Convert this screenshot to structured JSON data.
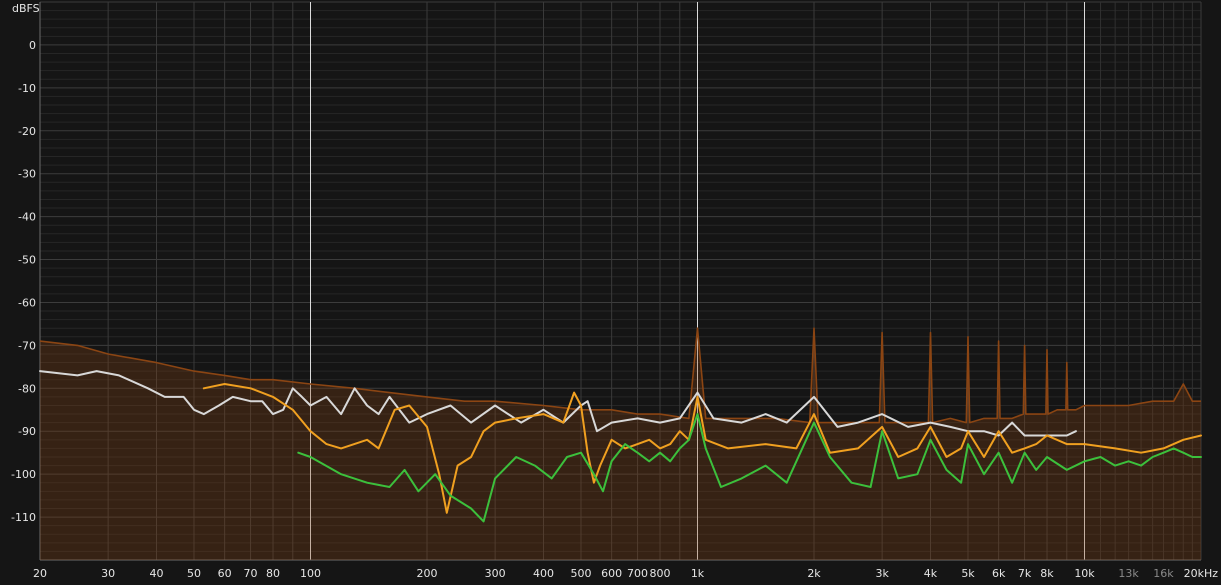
{
  "chart_data": {
    "type": "line",
    "ylabel": "dBFS",
    "x_scale": "log",
    "xlim": [
      20,
      20000
    ],
    "ylim": [
      -120,
      10
    ],
    "grid": true,
    "x_ticks": [
      {
        "value": 20,
        "label": "20"
      },
      {
        "value": 30,
        "label": "30"
      },
      {
        "value": 40,
        "label": "40"
      },
      {
        "value": 50,
        "label": "50"
      },
      {
        "value": 60,
        "label": "60"
      },
      {
        "value": 70,
        "label": "70"
      },
      {
        "value": 80,
        "label": "80"
      },
      {
        "value": 100,
        "label": "100"
      },
      {
        "value": 200,
        "label": "200"
      },
      {
        "value": 300,
        "label": "300"
      },
      {
        "value": 400,
        "label": "400"
      },
      {
        "value": 500,
        "label": "500"
      },
      {
        "value": 600,
        "label": "600"
      },
      {
        "value": 700,
        "label": "700"
      },
      {
        "value": 800,
        "label": "800"
      },
      {
        "value": 1000,
        "label": "1k"
      },
      {
        "value": 2000,
        "label": "2k"
      },
      {
        "value": 3000,
        "label": "3k"
      },
      {
        "value": 4000,
        "label": "4k"
      },
      {
        "value": 5000,
        "label": "5k"
      },
      {
        "value": 6000,
        "label": "6k"
      },
      {
        "value": 7000,
        "label": "7k"
      },
      {
        "value": 8000,
        "label": "8k"
      },
      {
        "value": 10000,
        "label": "10k"
      },
      {
        "value": 13000,
        "label": "13k"
      },
      {
        "value": 16000,
        "label": "16k"
      },
      {
        "value": 20000,
        "label": "20kHz"
      }
    ],
    "y_ticks": [
      0,
      -10,
      -20,
      -30,
      -40,
      -50,
      -60,
      -70,
      -80,
      -90,
      -100,
      -110
    ],
    "series": [
      {
        "color": "#8b4513",
        "style": "filled",
        "points": [
          [
            20,
            -69
          ],
          [
            25,
            -70
          ],
          [
            30,
            -72
          ],
          [
            40,
            -74
          ],
          [
            50,
            -76
          ],
          [
            60,
            -77
          ],
          [
            70,
            -78
          ],
          [
            80,
            -78
          ],
          [
            100,
            -79
          ],
          [
            130,
            -80
          ],
          [
            160,
            -81
          ],
          [
            200,
            -82
          ],
          [
            250,
            -83
          ],
          [
            300,
            -83
          ],
          [
            400,
            -84
          ],
          [
            500,
            -85
          ],
          [
            600,
            -85
          ],
          [
            700,
            -86
          ],
          [
            800,
            -86
          ],
          [
            950,
            -87
          ],
          [
            1000,
            -66
          ],
          [
            1050,
            -87
          ],
          [
            1300,
            -87
          ],
          [
            1600,
            -87
          ],
          [
            1950,
            -88
          ],
          [
            2000,
            -66
          ],
          [
            2050,
            -88
          ],
          [
            2500,
            -88
          ],
          [
            2950,
            -88
          ],
          [
            3000,
            -67
          ],
          [
            3050,
            -88
          ],
          [
            3500,
            -88
          ],
          [
            3950,
            -88
          ],
          [
            4000,
            -67
          ],
          [
            4050,
            -88
          ],
          [
            4500,
            -87
          ],
          [
            4950,
            -88
          ],
          [
            5000,
            -68
          ],
          [
            5050,
            -88
          ],
          [
            5500,
            -87
          ],
          [
            5950,
            -87
          ],
          [
            6000,
            -69
          ],
          [
            6050,
            -87
          ],
          [
            6500,
            -87
          ],
          [
            6950,
            -86
          ],
          [
            7000,
            -70
          ],
          [
            7050,
            -86
          ],
          [
            7500,
            -86
          ],
          [
            7950,
            -86
          ],
          [
            8000,
            -71
          ],
          [
            8050,
            -86
          ],
          [
            8500,
            -85
          ],
          [
            8950,
            -85
          ],
          [
            9000,
            -74
          ],
          [
            9050,
            -85
          ],
          [
            9500,
            -85
          ],
          [
            10000,
            -84
          ],
          [
            11000,
            -84
          ],
          [
            12000,
            -84
          ],
          [
            13000,
            -84
          ],
          [
            15000,
            -83
          ],
          [
            17000,
            -83
          ],
          [
            18000,
            -79
          ],
          [
            19000,
            -83
          ],
          [
            20000,
            -83
          ]
        ]
      },
      {
        "color": "#d8d8d8",
        "style": "line",
        "points": [
          [
            20,
            -76
          ],
          [
            25,
            -77
          ],
          [
            28,
            -76
          ],
          [
            32,
            -77
          ],
          [
            38,
            -80
          ],
          [
            42,
            -82
          ],
          [
            47,
            -82
          ],
          [
            50,
            -85
          ],
          [
            53,
            -86
          ],
          [
            58,
            -84
          ],
          [
            63,
            -82
          ],
          [
            70,
            -83
          ],
          [
            75,
            -83
          ],
          [
            80,
            -86
          ],
          [
            85,
            -85
          ],
          [
            90,
            -80
          ],
          [
            95,
            -82
          ],
          [
            100,
            -84
          ],
          [
            110,
            -82
          ],
          [
            120,
            -86
          ],
          [
            130,
            -80
          ],
          [
            140,
            -84
          ],
          [
            150,
            -86
          ],
          [
            160,
            -82
          ],
          [
            180,
            -88
          ],
          [
            200,
            -86
          ],
          [
            230,
            -84
          ],
          [
            260,
            -88
          ],
          [
            300,
            -84
          ],
          [
            350,
            -88
          ],
          [
            400,
            -85
          ],
          [
            450,
            -88
          ],
          [
            500,
            -84
          ],
          [
            520,
            -83
          ],
          [
            550,
            -90
          ],
          [
            600,
            -88
          ],
          [
            700,
            -87
          ],
          [
            800,
            -88
          ],
          [
            900,
            -87
          ],
          [
            1000,
            -81
          ],
          [
            1100,
            -87
          ],
          [
            1300,
            -88
          ],
          [
            1500,
            -86
          ],
          [
            1700,
            -88
          ],
          [
            2000,
            -82
          ],
          [
            2300,
            -89
          ],
          [
            2600,
            -88
          ],
          [
            3000,
            -86
          ],
          [
            3500,
            -89
          ],
          [
            4000,
            -88
          ],
          [
            4500,
            -89
          ],
          [
            5000,
            -90
          ],
          [
            5500,
            -90
          ],
          [
            6000,
            -91
          ],
          [
            6500,
            -88
          ],
          [
            7000,
            -91
          ],
          [
            7500,
            -91
          ],
          [
            8000,
            -91
          ],
          [
            8500,
            -91
          ],
          [
            9000,
            -91
          ],
          [
            9500,
            -90
          ]
        ]
      },
      {
        "color": "#f0a020",
        "style": "line",
        "points": [
          [
            53,
            -80
          ],
          [
            60,
            -79
          ],
          [
            70,
            -80
          ],
          [
            80,
            -82
          ],
          [
            90,
            -85
          ],
          [
            100,
            -90
          ],
          [
            110,
            -93
          ],
          [
            120,
            -94
          ],
          [
            140,
            -92
          ],
          [
            150,
            -94
          ],
          [
            165,
            -85
          ],
          [
            180,
            -84
          ],
          [
            200,
            -89
          ],
          [
            215,
            -100
          ],
          [
            225,
            -109
          ],
          [
            240,
            -98
          ],
          [
            260,
            -96
          ],
          [
            280,
            -90
          ],
          [
            300,
            -88
          ],
          [
            340,
            -87
          ],
          [
            400,
            -86
          ],
          [
            450,
            -88
          ],
          [
            480,
            -81
          ],
          [
            500,
            -84
          ],
          [
            520,
            -95
          ],
          [
            540,
            -102
          ],
          [
            560,
            -98
          ],
          [
            600,
            -92
          ],
          [
            650,
            -94
          ],
          [
            700,
            -93
          ],
          [
            750,
            -92
          ],
          [
            800,
            -94
          ],
          [
            850,
            -93
          ],
          [
            900,
            -90
          ],
          [
            950,
            -92
          ],
          [
            1000,
            -82
          ],
          [
            1050,
            -92
          ],
          [
            1200,
            -94
          ],
          [
            1500,
            -93
          ],
          [
            1800,
            -94
          ],
          [
            2000,
            -86
          ],
          [
            2200,
            -95
          ],
          [
            2600,
            -94
          ],
          [
            3000,
            -89
          ],
          [
            3300,
            -96
          ],
          [
            3700,
            -94
          ],
          [
            4000,
            -89
          ],
          [
            4400,
            -96
          ],
          [
            4800,
            -94
          ],
          [
            5000,
            -90
          ],
          [
            5500,
            -96
          ],
          [
            6000,
            -90
          ],
          [
            6500,
            -95
          ],
          [
            7000,
            -94
          ],
          [
            7500,
            -93
          ],
          [
            8000,
            -91
          ],
          [
            9000,
            -93
          ],
          [
            10000,
            -93
          ],
          [
            12000,
            -94
          ],
          [
            14000,
            -95
          ],
          [
            16000,
            -94
          ],
          [
            18000,
            -92
          ],
          [
            20000,
            -91
          ]
        ]
      },
      {
        "color": "#3cc03c",
        "style": "line",
        "points": [
          [
            93,
            -95
          ],
          [
            100,
            -96
          ],
          [
            120,
            -100
          ],
          [
            140,
            -102
          ],
          [
            160,
            -103
          ],
          [
            175,
            -99
          ],
          [
            190,
            -104
          ],
          [
            210,
            -100
          ],
          [
            230,
            -105
          ],
          [
            260,
            -108
          ],
          [
            280,
            -111
          ],
          [
            300,
            -101
          ],
          [
            340,
            -96
          ],
          [
            380,
            -98
          ],
          [
            420,
            -101
          ],
          [
            460,
            -96
          ],
          [
            500,
            -95
          ],
          [
            540,
            -100
          ],
          [
            570,
            -104
          ],
          [
            600,
            -97
          ],
          [
            650,
            -93
          ],
          [
            700,
            -95
          ],
          [
            750,
            -97
          ],
          [
            800,
            -95
          ],
          [
            850,
            -97
          ],
          [
            900,
            -94
          ],
          [
            950,
            -92
          ],
          [
            1000,
            -86
          ],
          [
            1050,
            -94
          ],
          [
            1150,
            -103
          ],
          [
            1300,
            -101
          ],
          [
            1500,
            -98
          ],
          [
            1700,
            -102
          ],
          [
            2000,
            -88
          ],
          [
            2200,
            -96
          ],
          [
            2500,
            -102
          ],
          [
            2800,
            -103
          ],
          [
            3000,
            -90
          ],
          [
            3300,
            -101
          ],
          [
            3700,
            -100
          ],
          [
            4000,
            -92
          ],
          [
            4400,
            -99
          ],
          [
            4800,
            -102
          ],
          [
            5000,
            -93
          ],
          [
            5500,
            -100
          ],
          [
            6000,
            -95
          ],
          [
            6500,
            -102
          ],
          [
            7000,
            -95
          ],
          [
            7500,
            -99
          ],
          [
            8000,
            -96
          ],
          [
            9000,
            -99
          ],
          [
            10000,
            -97
          ],
          [
            11000,
            -96
          ],
          [
            12000,
            -98
          ],
          [
            13000,
            -97
          ],
          [
            14000,
            -98
          ],
          [
            15000,
            -96
          ],
          [
            16000,
            -95
          ],
          [
            17000,
            -94
          ],
          [
            18000,
            -95
          ],
          [
            19000,
            -96
          ],
          [
            20000,
            -96
          ]
        ]
      }
    ]
  },
  "colors": {
    "background": "#151515",
    "grid_major": "#dcdcdc",
    "grid_minor": "#3a3a3a",
    "grid_decade_fine": "#303030",
    "axis": "#6a6a6a",
    "tick_text": "#e6e6e6",
    "tick_text_dim": "#8a8a8a"
  }
}
